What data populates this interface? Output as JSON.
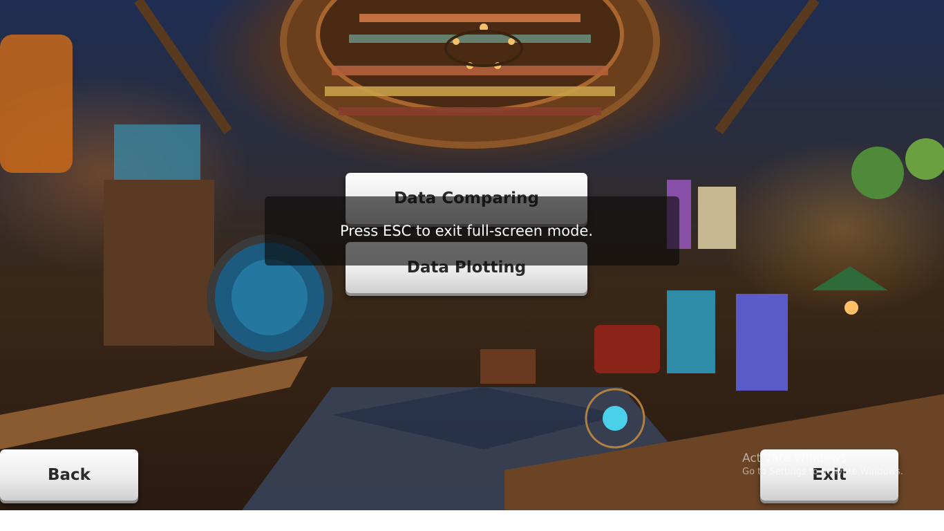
{
  "menu": {
    "data_comparing_label": "Data Comparing",
    "data_plotting_label": "Data Plotting"
  },
  "nav": {
    "back_label": "Back",
    "exit_label": "Exit"
  },
  "fullscreen_notice": {
    "text": "Press ESC to exit full-screen mode."
  },
  "windows_watermark": {
    "title": "Activate Windows",
    "subtitle": "Go to Settings to activate Windows."
  },
  "colors": {
    "button_face": "#ececec",
    "button_text": "#2a2a2a",
    "toast_background": "#0a0a0a"
  }
}
